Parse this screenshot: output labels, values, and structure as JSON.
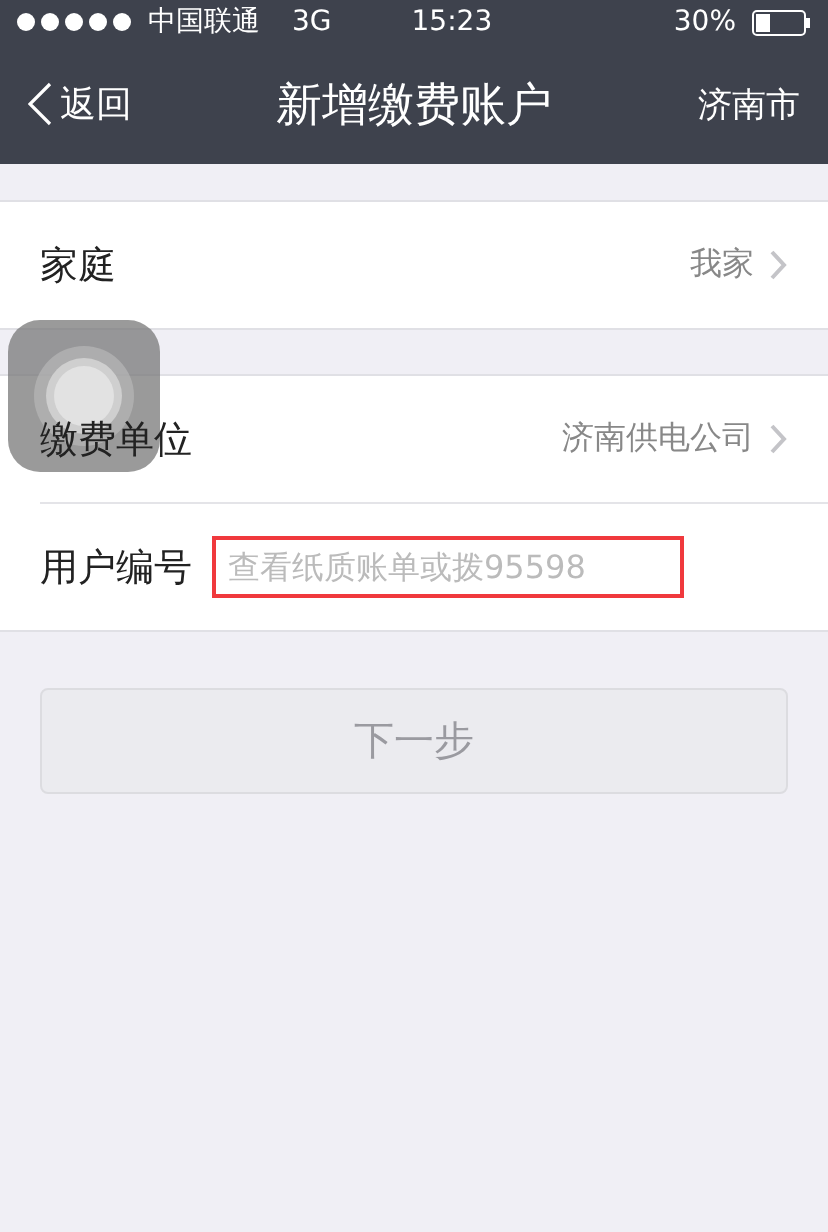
{
  "status_bar": {
    "carrier": "中国联通",
    "network": "3G",
    "time": "15:23",
    "battery": "30%"
  },
  "nav_bar": {
    "back": "返回",
    "title": "新增缴费账户",
    "action": "济南市"
  },
  "groups": [
    {
      "rows": [
        {
          "kind": "select",
          "label": "家庭",
          "value": "我家"
        }
      ]
    },
    {
      "rows": [
        {
          "kind": "select",
          "label": "缴费单位",
          "value": "济南供电公司"
        },
        {
          "kind": "input",
          "label": "用户编号",
          "placeholder": "查看纸质账单或拨95598",
          "highlighted": true
        }
      ]
    }
  ],
  "next_button": {
    "label": "下一步",
    "disabled": true
  },
  "assistive_touch": {
    "visible": true
  }
}
